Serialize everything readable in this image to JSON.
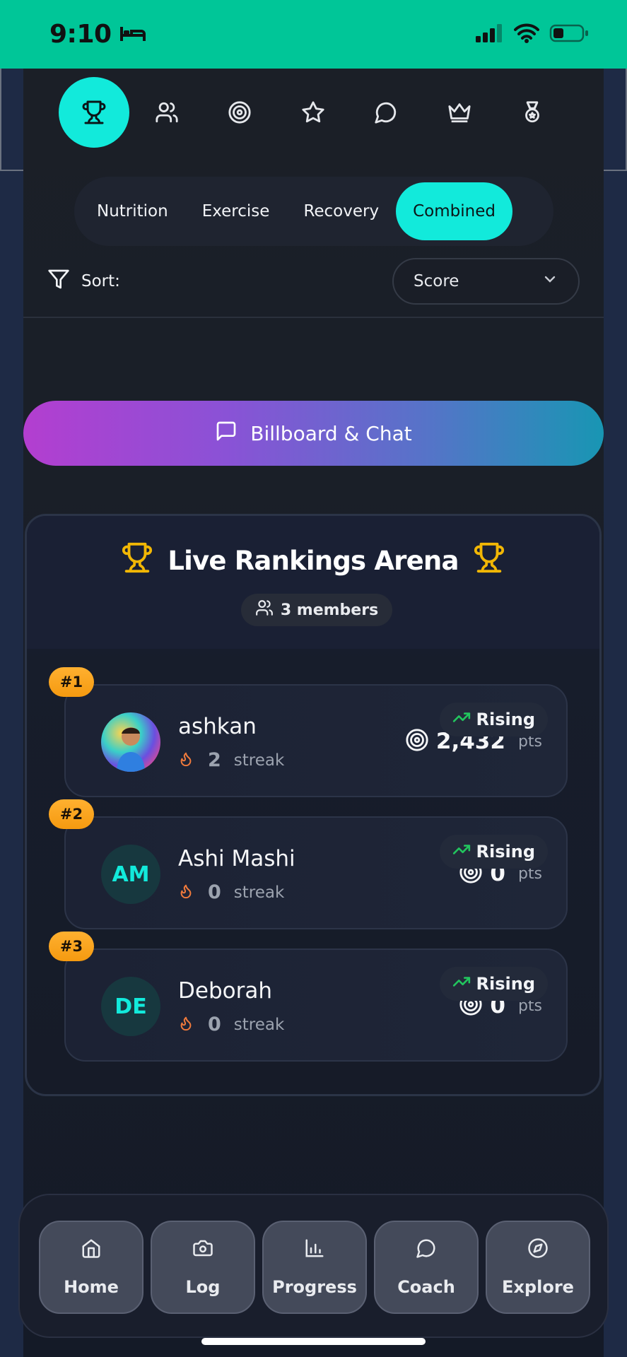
{
  "status_bar": {
    "time": "9:10",
    "icons": [
      "bed-icon",
      "signal-icon",
      "wifi-icon",
      "battery-icon"
    ]
  },
  "top_nav": {
    "icons": [
      "trophy-icon",
      "users-icon",
      "target-icon",
      "star-icon",
      "chat-icon",
      "crown-icon",
      "medal-icon"
    ],
    "active": "trophy-icon"
  },
  "filter_tabs": {
    "items": [
      "Nutrition",
      "Exercise",
      "Recovery",
      "Combined"
    ],
    "active": "Combined"
  },
  "sort": {
    "label": "Sort:",
    "value": "Score"
  },
  "billboard_button": {
    "label": "Billboard & Chat"
  },
  "rankings": {
    "title": "Live Rankings Arena",
    "members": "3 members",
    "entries": [
      {
        "rank": "#1",
        "name": "ashkan",
        "avatar_initials": "",
        "streak": "2",
        "streak_label": "streak",
        "trend": "Rising",
        "score": "2,432",
        "score_unit": "pts"
      },
      {
        "rank": "#2",
        "name": "Ashi Mashi",
        "avatar_initials": "AM",
        "streak": "0",
        "streak_label": "streak",
        "trend": "Rising",
        "score": "0",
        "score_unit": "pts"
      },
      {
        "rank": "#3",
        "name": "Deborah",
        "avatar_initials": "DE",
        "streak": "0",
        "streak_label": "streak",
        "trend": "Rising",
        "score": "0",
        "score_unit": "pts"
      }
    ]
  },
  "bottom_nav": {
    "items": [
      {
        "label": "Home",
        "icon": "home-icon"
      },
      {
        "label": "Log",
        "icon": "camera-icon"
      },
      {
        "label": "Progress",
        "icon": "bar-chart-icon"
      },
      {
        "label": "Coach",
        "icon": "chat-icon"
      },
      {
        "label": "Explore",
        "icon": "compass-icon"
      }
    ]
  },
  "colors": {
    "accent": "#12eadb",
    "status_bar": "#00c698",
    "rank_badge": "#f5a623",
    "trophy": "#f2b705",
    "streak": "#f07a3c",
    "trend": "#22c55e"
  }
}
